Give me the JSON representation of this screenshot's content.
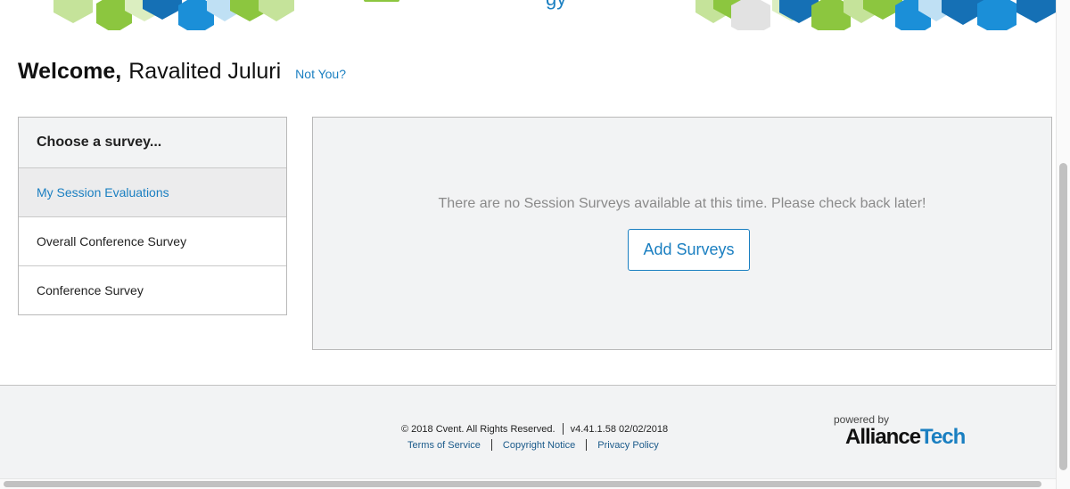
{
  "banner": {
    "partial_text": "gy"
  },
  "welcome": {
    "greeting": "Welcome,",
    "name": "Ravalited Juluri",
    "not_you": "Not You?"
  },
  "survey_menu": {
    "header": "Choose a survey...",
    "items": [
      {
        "label": "My Session Evaluations",
        "active": true
      },
      {
        "label": "Overall Conference Survey",
        "active": false
      },
      {
        "label": "Conference Survey",
        "active": false
      }
    ]
  },
  "content": {
    "message": "There are no Session Surveys available at this time. Please check back later!",
    "add_button": "Add Surveys"
  },
  "footer": {
    "copyright": "© 2018 Cvent. All Rights Reserved.",
    "version": "v4.41.1.58 02/02/2018",
    "links": [
      "Terms of Service",
      "Copyright Notice",
      "Privacy Policy"
    ],
    "powered_by": "powered by",
    "brand_part1": "Alliance",
    "brand_part2": "Tech"
  },
  "colors": {
    "accent": "#1a7fc1",
    "panel_bg": "#f2f3f4",
    "hex_green": "#8cc63f",
    "hex_light_green": "#c5e39a",
    "hex_blue": "#1b8fd8",
    "hex_dark_blue": "#1570b5"
  }
}
